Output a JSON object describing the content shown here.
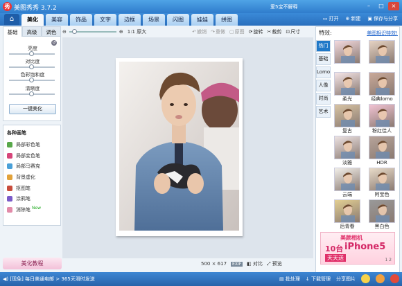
{
  "app": {
    "title": "美图秀秀 3.7.2",
    "logo_char": "秀",
    "user_text": "爱5宝不解释"
  },
  "window_controls": [
    "–",
    "□",
    "×"
  ],
  "nav": {
    "home_icon": "home-icon",
    "tabs": [
      "美化",
      "美容",
      "饰品",
      "文字",
      "边框",
      "场景",
      "闪图",
      "娃娃",
      "拼图"
    ],
    "active_tab": 0,
    "actions": [
      {
        "icon": "folder-icon",
        "label": "打开"
      },
      {
        "icon": "plus-icon",
        "label": "新建"
      },
      {
        "icon": "save-icon",
        "label": "保存与分享"
      }
    ]
  },
  "toolbar": {
    "zoom_label": "1:1 原大",
    "undo": "撤销",
    "redo": "重做",
    "original": "原图",
    "rotate": "旋转",
    "crop": "裁剪",
    "resize": "尺寸"
  },
  "left_panel": {
    "subtabs": [
      "基础",
      "高级",
      "调色"
    ],
    "active_subtab": 0,
    "sliders": [
      {
        "label": "亮度",
        "value": 0.5
      },
      {
        "label": "对比度",
        "value": 0.5
      },
      {
        "label": "色彩饱和度",
        "value": 0.5
      },
      {
        "label": "清晰度",
        "value": 0.5
      }
    ],
    "onekey_button": "一键美化",
    "brushes_title": "各种画笔",
    "brushes": [
      {
        "label": "局部彩色笔",
        "color": "#58a84a"
      },
      {
        "label": "局部变色笔",
        "color": "#d6457a"
      },
      {
        "label": "局部马赛克",
        "color": "#4aa0d8"
      },
      {
        "label": "背景虚化",
        "color": "#e2a23a"
      },
      {
        "label": "抠图笔",
        "color": "#c84c3c"
      },
      {
        "label": "涂鸦笔",
        "color": "#7a5ac8"
      },
      {
        "label": "消除笔",
        "color": "#e28aa8",
        "tag": "New"
      }
    ],
    "tutorial_button": "美化教程"
  },
  "status": {
    "dimensions": "500 × 617",
    "exif": "EXIF",
    "compare": "对比",
    "preview": "预览"
  },
  "effects": {
    "title": "特效:",
    "link": "美图相识特效!",
    "categories": [
      "热门",
      "基础",
      "Lomo",
      "人像",
      "时尚",
      "艺术"
    ],
    "active_category": 0,
    "items": [
      {
        "label": "",
        "tone": "#f3d9de"
      },
      {
        "label": "",
        "tone": "#e6d3c3"
      },
      {
        "label": "柔光",
        "tone": "#f5e5e7"
      },
      {
        "label": "经典lomo",
        "tone": "#c9a999"
      },
      {
        "label": "复古",
        "tone": "#d8c4a4"
      },
      {
        "label": "粉红佳人",
        "tone": "#f2c3d3"
      },
      {
        "label": "淡雅",
        "tone": "#ede3e3"
      },
      {
        "label": "HDR",
        "tone": "#b7a49a"
      },
      {
        "label": "云端",
        "tone": "#f2efe9"
      },
      {
        "label": "阿宝色",
        "tone": "#e8dbc8"
      },
      {
        "label": "后青春",
        "tone": "#e3cf92"
      },
      {
        "label": "黑白色",
        "tone": "#999999"
      }
    ]
  },
  "ad": {
    "brand": "美颜相机",
    "text1": "10台",
    "text2": "iPhone5",
    "text3": "天天送",
    "pager": "1 2"
  },
  "bottom": {
    "left_text": "[现免] 每日美通电邮 > 365天滑时发送",
    "actions": [
      "批处理",
      "下载管理",
      "分享图片"
    ]
  }
}
